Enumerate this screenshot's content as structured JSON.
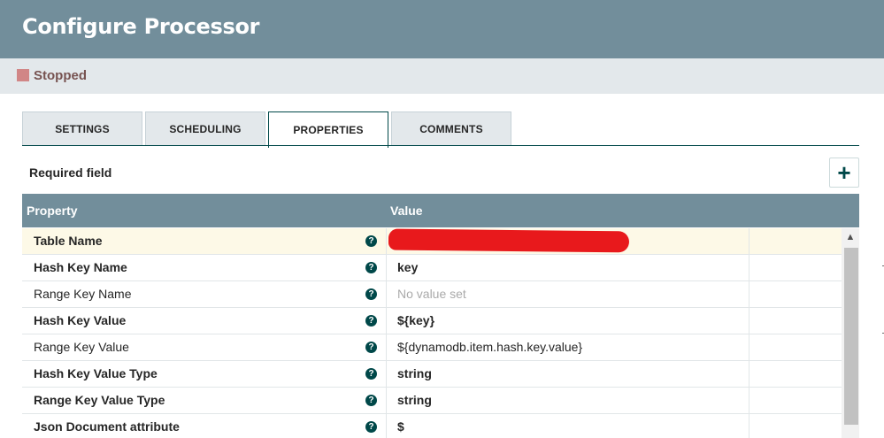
{
  "dialog": {
    "title": "Configure Processor"
  },
  "status": {
    "text": "Stopped",
    "color": "#d18686"
  },
  "tabs": [
    {
      "label": "SETTINGS",
      "active": false
    },
    {
      "label": "SCHEDULING",
      "active": false
    },
    {
      "label": "PROPERTIES",
      "active": true
    },
    {
      "label": "COMMENTS",
      "active": false
    }
  ],
  "properties": {
    "required_label": "Required field",
    "add_icon": "+",
    "columns": {
      "property": "Property",
      "value": "Value"
    },
    "rows": [
      {
        "name": "Table Name",
        "value": "",
        "required": true,
        "redacted": true
      },
      {
        "name": "Hash Key Name",
        "value": "key",
        "required": true
      },
      {
        "name": "Range Key Name",
        "value": "No value set",
        "required": false,
        "placeholder": true
      },
      {
        "name": "Hash Key Value",
        "value": "${key}",
        "required": true
      },
      {
        "name": "Range Key Value",
        "value": "${dynamodb.item.hash.key.value}",
        "required": false
      },
      {
        "name": "Hash Key Value Type",
        "value": "string",
        "required": true
      },
      {
        "name": "Range Key Value Type",
        "value": "string",
        "required": true
      },
      {
        "name": "Json Document attribute",
        "value": "$",
        "required": true
      }
    ],
    "help_icon": "?"
  },
  "scrollbar": {
    "up_arrow": "▲"
  },
  "colors": {
    "header": "#728e9b",
    "accent": "#004849",
    "selected_row": "#fdf9e7",
    "redaction": "#e8191c"
  }
}
